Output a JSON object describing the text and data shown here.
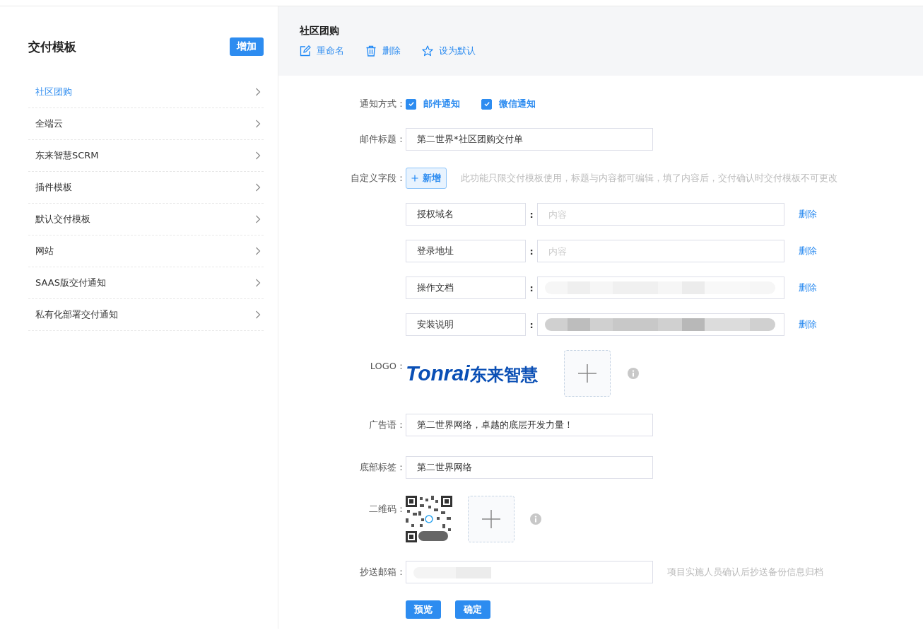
{
  "sidebar": {
    "title": "交付模板",
    "add_button": "增加",
    "items": [
      {
        "label": "社区团购",
        "selected": true
      },
      {
        "label": "全端云",
        "selected": false
      },
      {
        "label": "东来智慧SCRM",
        "selected": false
      },
      {
        "label": "插件模板",
        "selected": false
      },
      {
        "label": "默认交付模板",
        "selected": false
      },
      {
        "label": "网站",
        "selected": false
      },
      {
        "label": "SAAS版交付通知",
        "selected": false
      },
      {
        "label": "私有化部署交付通知",
        "selected": false
      }
    ]
  },
  "header": {
    "title": "社区团购",
    "actions": [
      {
        "kind": "edit",
        "label": "重命名"
      },
      {
        "kind": "delete",
        "label": "删除"
      },
      {
        "kind": "star",
        "label": "设为默认"
      }
    ]
  },
  "form": {
    "notify": {
      "label": "通知方式：",
      "options": [
        {
          "label": "邮件通知",
          "checked": true
        },
        {
          "label": "微信通知",
          "checked": true
        }
      ]
    },
    "mail_title": {
      "label": "邮件标题：",
      "value": "第二世界*社区团购交付单"
    },
    "custom": {
      "label": "自定义字段：",
      "add_button": "新增",
      "hint": "此功能只限交付模板使用，标题与内容都可编辑，填了内容后，交付确认时交付模板不可更改",
      "fields": [
        {
          "name": "授权域名",
          "separator": ":",
          "placeholder": "内容",
          "redacted": false,
          "delete": "删除"
        },
        {
          "name": "登录地址",
          "separator": ":",
          "placeholder": "内容",
          "redacted": false,
          "delete": "删除"
        },
        {
          "name": "操作文档",
          "separator": ":",
          "redacted": true,
          "delete": "删除"
        },
        {
          "name": "安装说明",
          "separator": ":",
          "redacted": true,
          "delete": "删除"
        }
      ]
    },
    "logo": {
      "label": "LOGO：",
      "brand_latin": "Tonrai",
      "brand_cn": "东来智慧"
    },
    "slogan": {
      "label": "广告语：",
      "value": "第二世界网络，卓越的底层开发力量！"
    },
    "footer_tag": {
      "label": "底部标签：",
      "value": "第二世界网络"
    },
    "qrcode": {
      "label": "二维码："
    },
    "cc_mail": {
      "label": "抄送邮箱：",
      "redacted": true,
      "hint": "项目实施人员确认后抄送备份信息归档"
    },
    "buttons": [
      "预览",
      "确定"
    ]
  }
}
